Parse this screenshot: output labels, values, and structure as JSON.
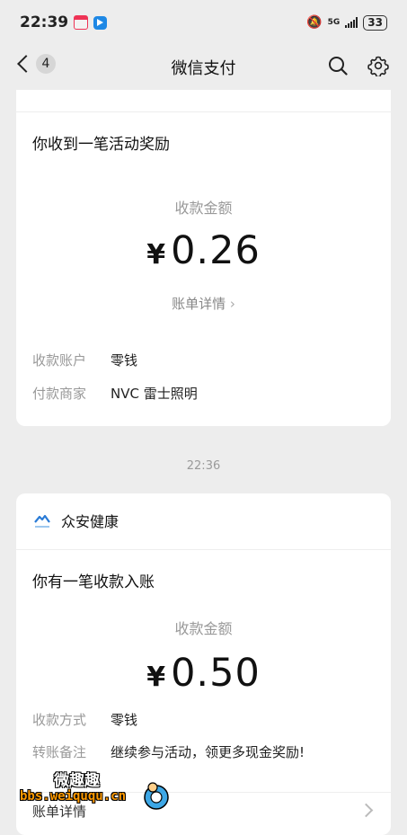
{
  "status_bar": {
    "time": "22:39",
    "network": "5G",
    "battery": "33"
  },
  "nav": {
    "back_badge": "4",
    "title": "微信支付"
  },
  "card1": {
    "title": "你收到一笔活动奖励",
    "amount_label": "收款金额",
    "currency": "¥",
    "amount": "0.26",
    "detail_link": "账单详情 ",
    "rows": [
      {
        "key": "收款账户",
        "value": "零钱"
      },
      {
        "key": "付款商家",
        "value": "NVC 雷士照明"
      }
    ]
  },
  "timestamp": "22:36",
  "card2": {
    "brand": "众安健康",
    "title": "你有一笔收款入账",
    "amount_label": "收款金额",
    "currency": "¥",
    "amount": "0.50",
    "rows": [
      {
        "key": "收款方式",
        "value": "零钱"
      },
      {
        "key": "转账备注",
        "value": "继续参与活动，领更多现金奖励!"
      }
    ],
    "bottom_label": "账单详情"
  },
  "watermark": {
    "title": "微趣趣",
    "url": "bbs.weiququ.cn"
  },
  "colors": {
    "background": "#ededed",
    "card": "#ffffff",
    "muted": "#999999",
    "brand_blue": "#2a7bd6"
  }
}
